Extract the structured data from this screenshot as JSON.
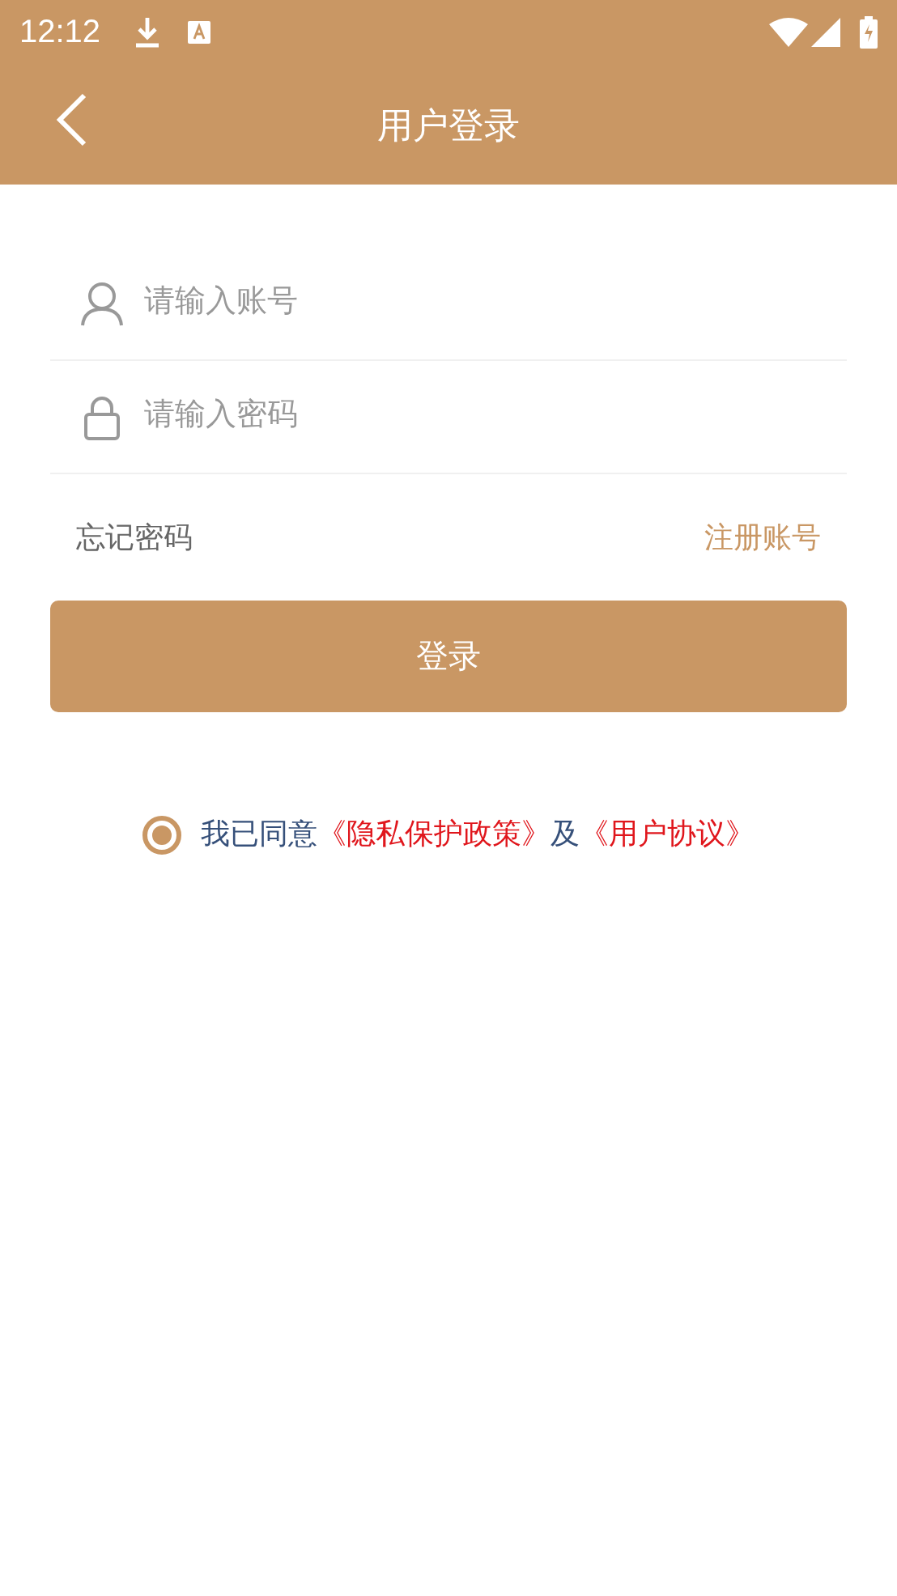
{
  "status_bar": {
    "time": "12:12"
  },
  "app_bar": {
    "title": "用户登录"
  },
  "fields": [
    {
      "kind": "account",
      "placeholder": "请输入账号"
    },
    {
      "kind": "password",
      "placeholder": "请输入密码"
    }
  ],
  "links": {
    "forgot": "忘记密码",
    "register": "注册账号"
  },
  "login_button": "登录",
  "agreement": {
    "checked": true,
    "parts": [
      {
        "kind": "text",
        "text": "我已同意"
      },
      {
        "kind": "link",
        "text": "《隐私保护政策》"
      },
      {
        "kind": "text",
        "text": "及"
      },
      {
        "kind": "link",
        "text": "《用户协议》"
      }
    ]
  }
}
